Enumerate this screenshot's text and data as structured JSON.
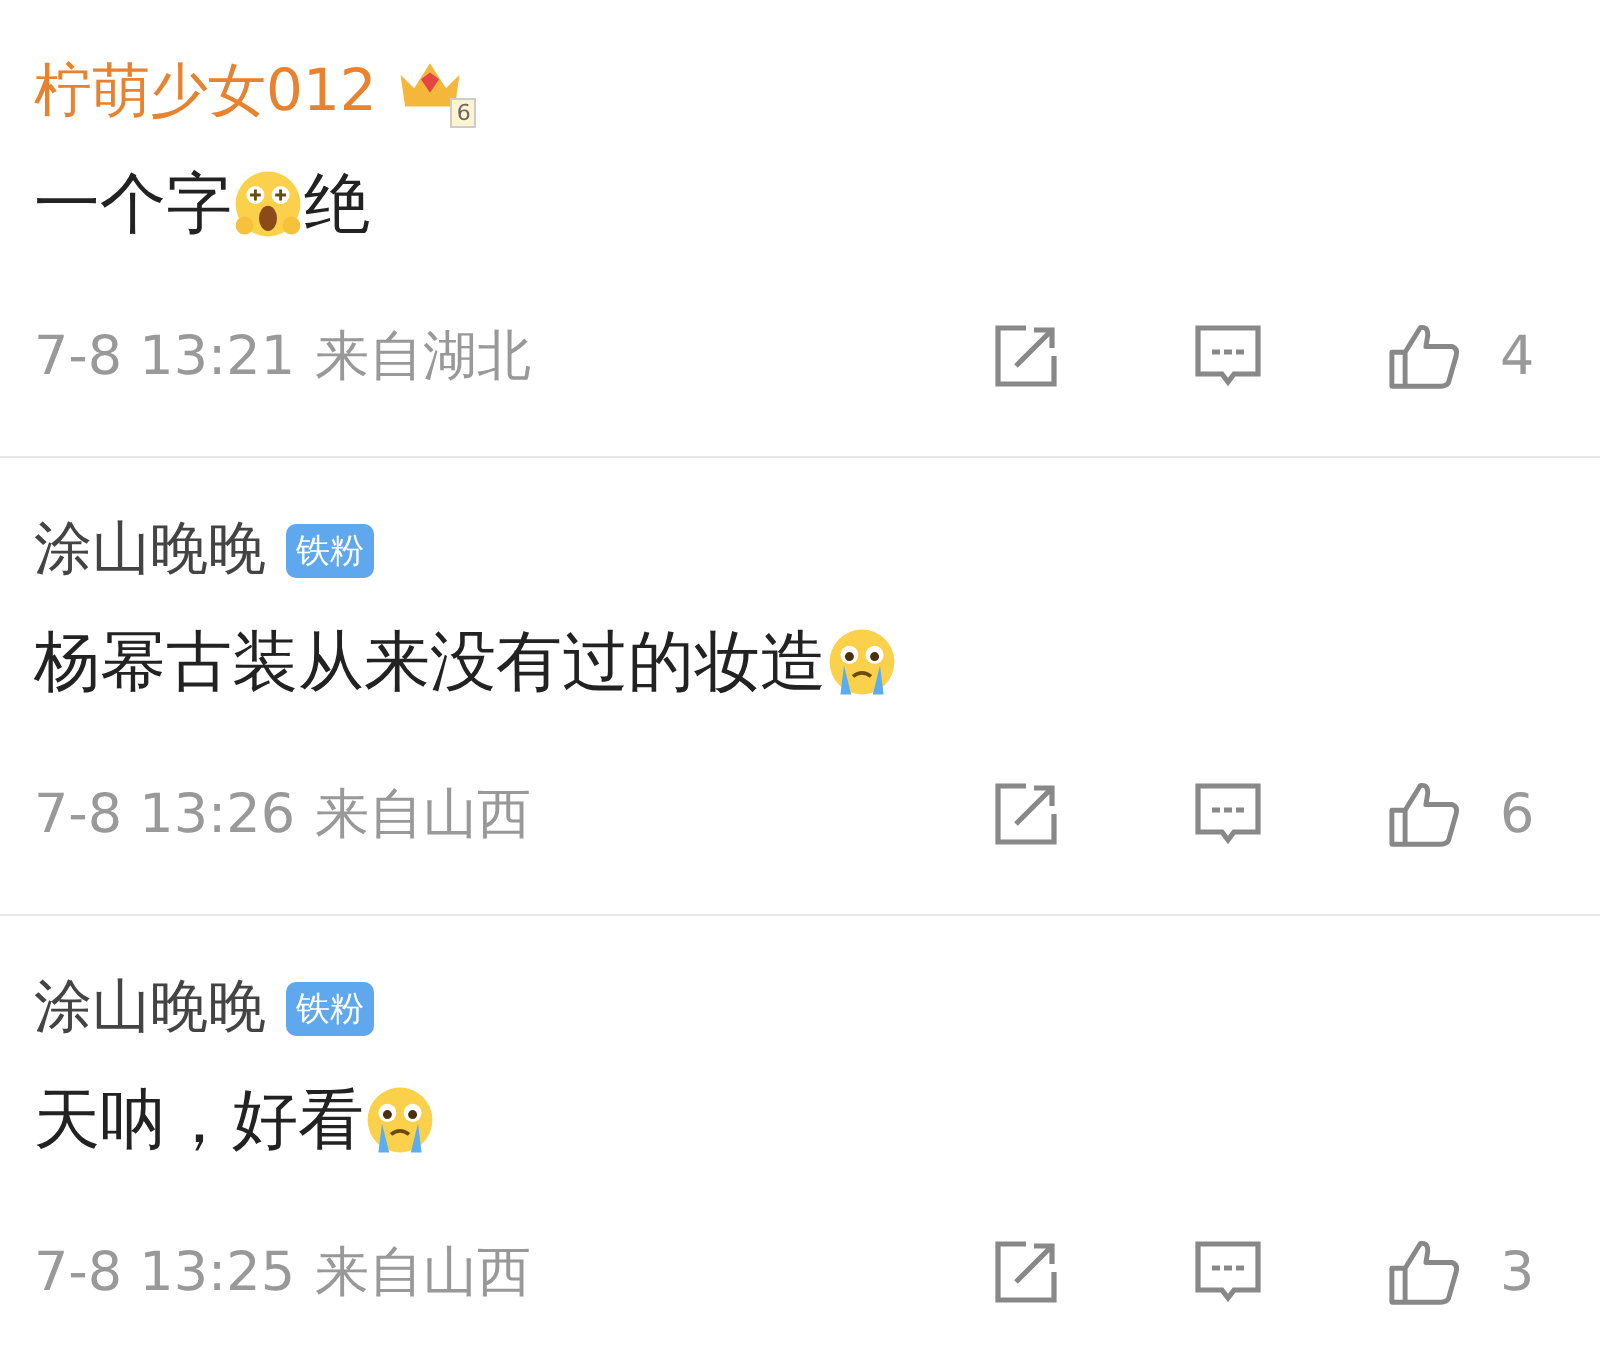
{
  "comments": [
    {
      "user": "柠萌少女012",
      "badge": {
        "kind": "vip",
        "label": "6"
      },
      "body": [
        {
          "kind": "text",
          "text": "一个字"
        },
        {
          "kind": "shocked"
        },
        {
          "kind": "text",
          "text": "绝"
        }
      ],
      "time": "7-8 13:21",
      "location": "来自湖北",
      "likes": "4"
    },
    {
      "user": "涂山晚晚",
      "badge": {
        "kind": "fan",
        "label": "铁粉"
      },
      "body": [
        {
          "kind": "text",
          "text": "杨幂古装从来没有过的妆造"
        },
        {
          "kind": "crying"
        }
      ],
      "time": "7-8 13:26",
      "location": "来自山西",
      "likes": "6"
    },
    {
      "user": "涂山晚晚",
      "badge": {
        "kind": "fan",
        "label": "铁粉"
      },
      "body": [
        {
          "kind": "text",
          "text": "天呐，好看"
        },
        {
          "kind": "crying"
        }
      ],
      "time": "7-8 13:25",
      "location": "来自山西",
      "likes": "3"
    }
  ]
}
